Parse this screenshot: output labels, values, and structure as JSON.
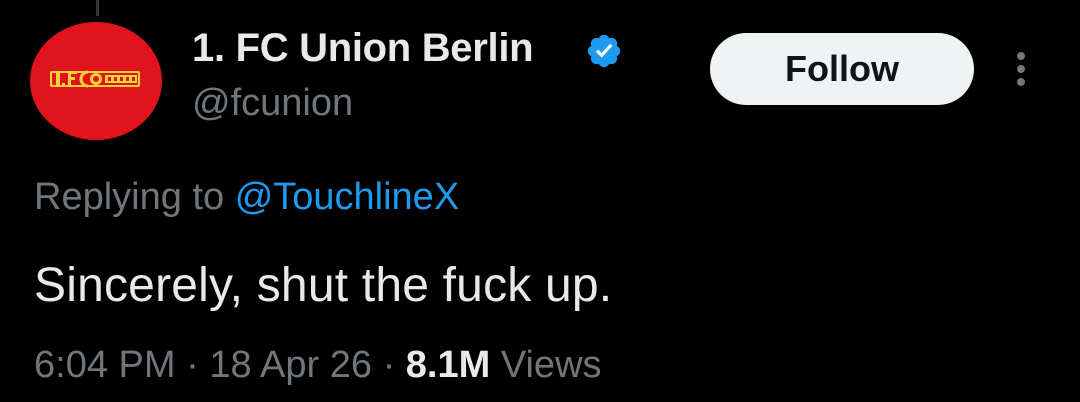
{
  "author": {
    "display_name": "1. FC Union Berlin",
    "handle": "@fcunion",
    "verified": true,
    "avatar_logo_text": "1.FC UNION"
  },
  "actions": {
    "follow_label": "Follow",
    "more_icon": "more-vertical-icon"
  },
  "reply": {
    "prefix": "Replying to",
    "to_handle": "@TouchlineX"
  },
  "tweet": {
    "text": "Sincerely, shut the fuck up."
  },
  "meta": {
    "time": "6:04 PM",
    "separator": "·",
    "date": "18 Apr 26",
    "views_count": "8.1M",
    "views_label": "Views"
  },
  "colors": {
    "background": "#000000",
    "primary_text": "#e7e9ea",
    "secondary_text": "#71767b",
    "link": "#1d9bf0",
    "verified_badge": "#1d9bf0",
    "avatar_red": "#e1141d",
    "logo_yellow": "#f6d23a",
    "follow_button_bg": "#eff3f4"
  }
}
